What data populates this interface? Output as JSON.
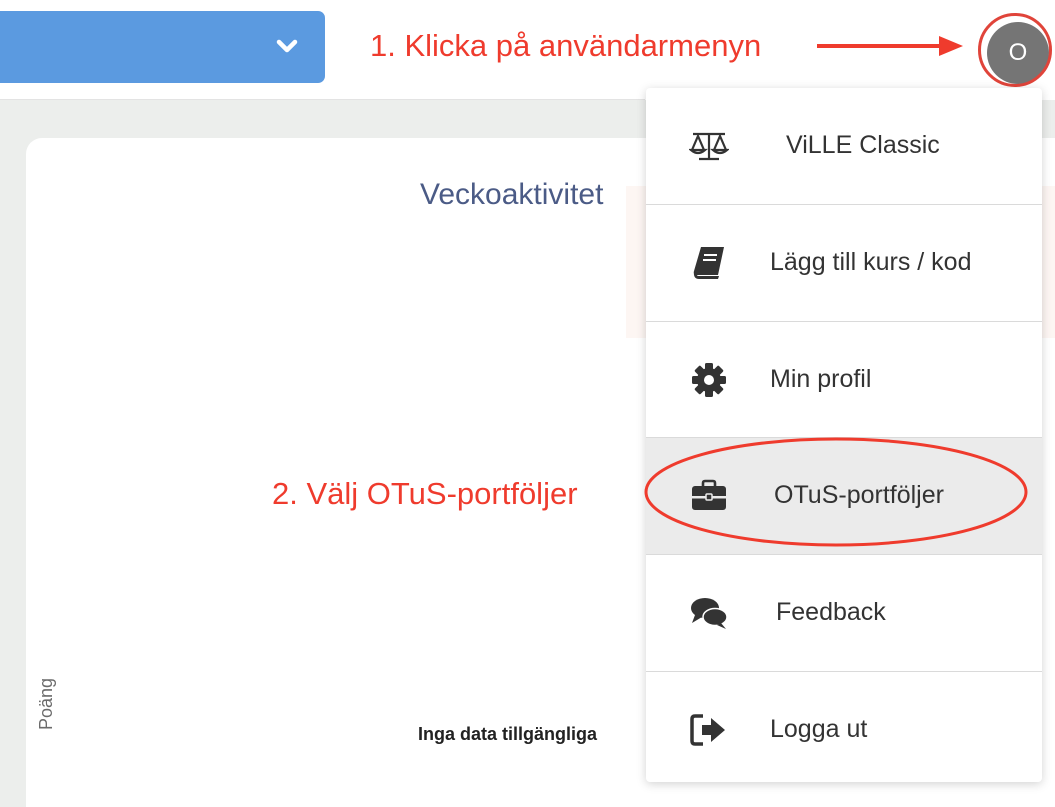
{
  "header": {
    "avatar_initial": "O"
  },
  "annotations": {
    "step1": "1. Klicka på användarmenyn",
    "step2": "2. Välj OTuS-portföljer",
    "color": "#ef3b2d"
  },
  "chart": {
    "title": "Veckoaktivitet",
    "ylabel": "Poäng",
    "empty_message": "Inga data tillgängliga"
  },
  "chart_data": {
    "type": "bar",
    "title": "Veckoaktivitet",
    "ylabel": "Poäng",
    "categories": [],
    "values": []
  },
  "user_menu": {
    "items": [
      {
        "label": "ViLLE Classic",
        "icon": "scale-icon"
      },
      {
        "label": "Lägg till kurs / kod",
        "icon": "book-icon"
      },
      {
        "label": "Min profil",
        "icon": "gear-icon"
      },
      {
        "label": "OTuS-portföljer",
        "icon": "briefcase-icon",
        "active": true
      },
      {
        "label": "Feedback",
        "icon": "comments-icon"
      },
      {
        "label": "Logga ut",
        "icon": "sign-out-icon"
      }
    ]
  },
  "colors": {
    "accent": "#5b9ae0",
    "title": "#4b5b86",
    "annotation": "#ef3b2d"
  }
}
